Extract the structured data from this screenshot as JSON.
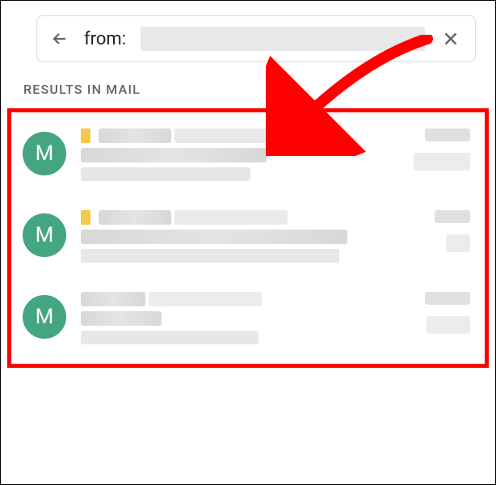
{
  "search": {
    "prefix": "from:"
  },
  "section": {
    "title": "RESULTS IN MAIL"
  },
  "emails": [
    {
      "avatar": "M"
    },
    {
      "avatar": "M"
    },
    {
      "avatar": "M"
    }
  ],
  "colors": {
    "avatar_bg": "#43a680",
    "highlight_border": "#ff0000",
    "arrow": "#ff0000"
  }
}
